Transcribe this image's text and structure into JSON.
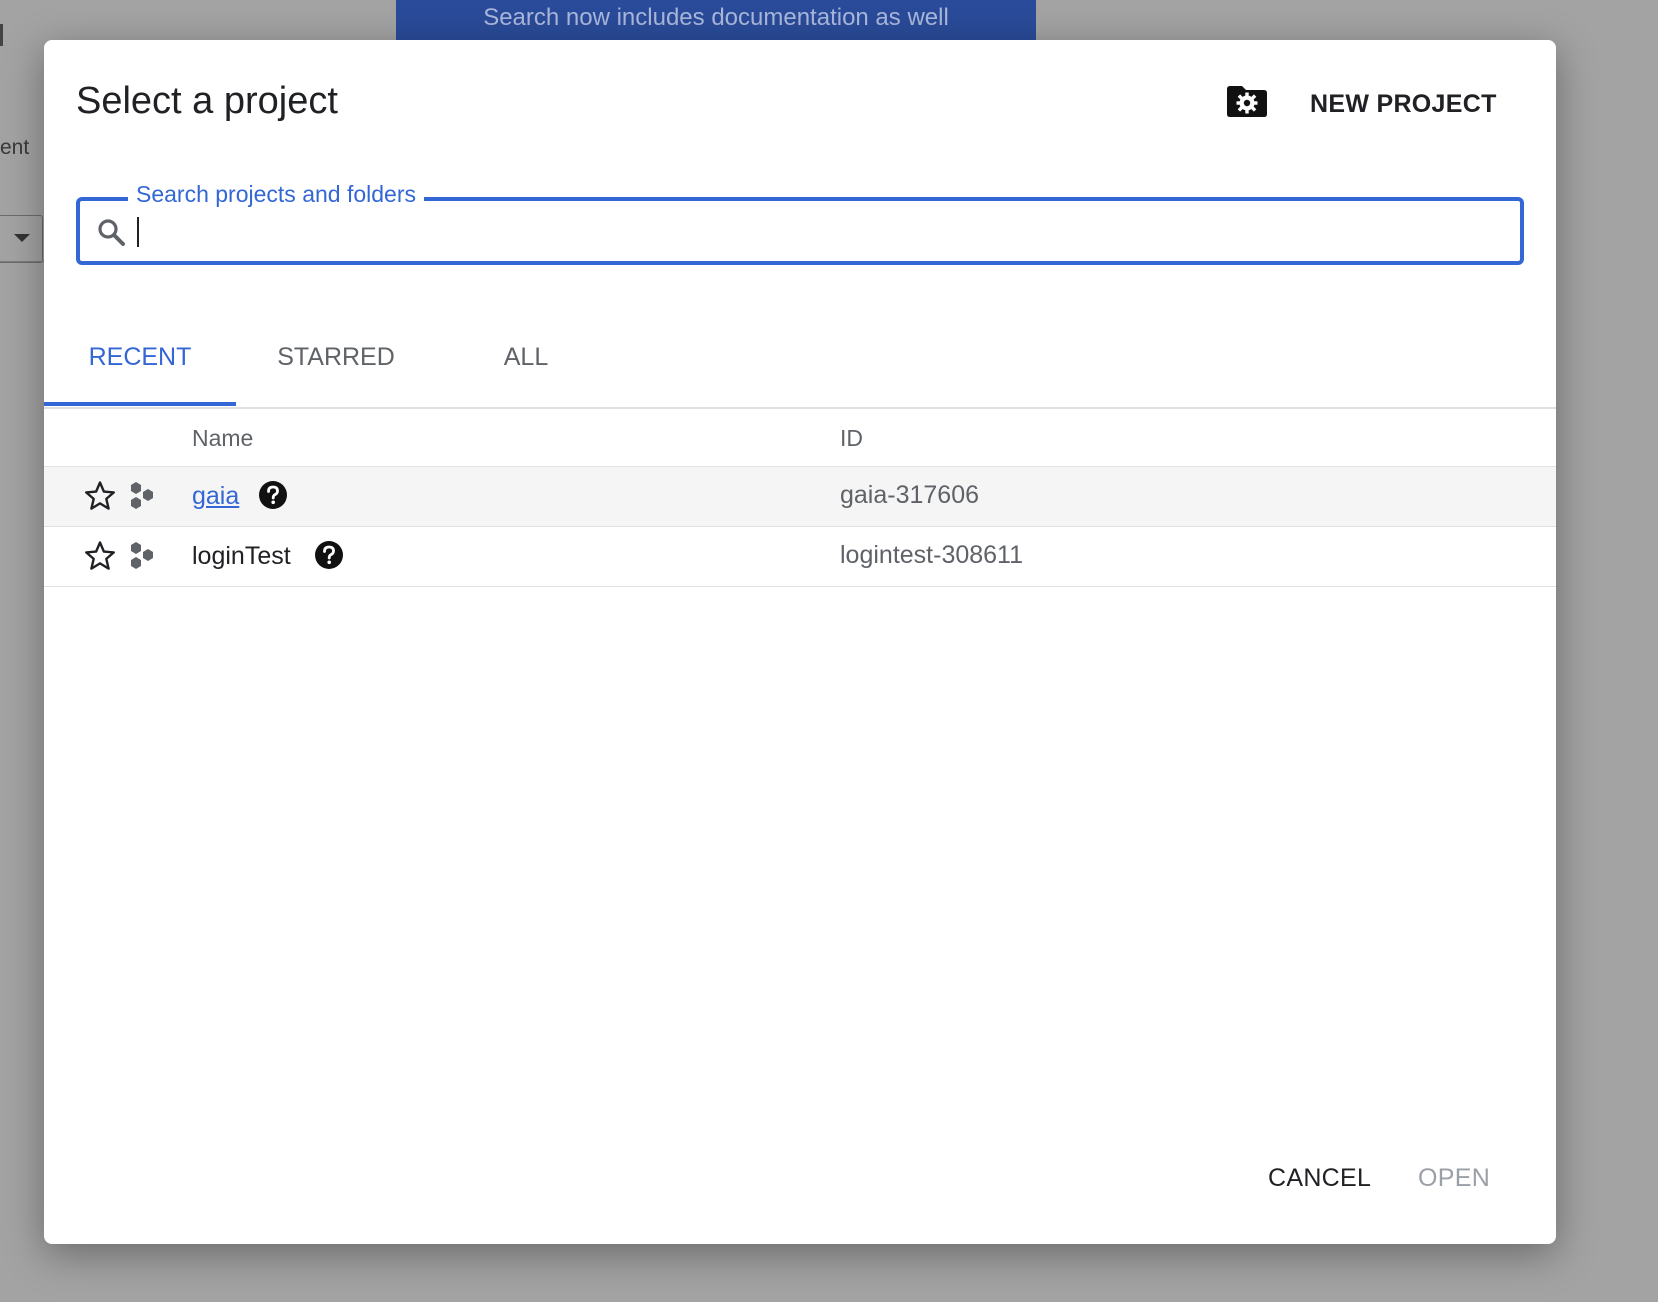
{
  "background": {
    "toast_text": "Search now includes documentation as well",
    "fragment_text": "ent"
  },
  "dialog": {
    "title": "Select a project",
    "new_project_label": "NEW PROJECT",
    "search": {
      "label": "Search projects and folders",
      "value": "",
      "placeholder": ""
    },
    "tabs": [
      {
        "label": "RECENT",
        "active": true
      },
      {
        "label": "STARRED",
        "active": false
      },
      {
        "label": "ALL",
        "active": false
      }
    ],
    "table": {
      "headers": {
        "name": "Name",
        "id": "ID"
      },
      "rows": [
        {
          "name": "gaia",
          "id": "gaia-317606",
          "starred": false
        },
        {
          "name": "loginTest",
          "id": "logintest-308611",
          "starred": false
        }
      ]
    },
    "cancel_label": "CANCEL",
    "open_label": "OPEN"
  },
  "colors": {
    "accent": "#3367d6",
    "toast_bg": "#2a4b99",
    "row_highlight": "#f5f5f5"
  },
  "icons": {
    "new_project": "folder-settings-icon",
    "search": "search-icon",
    "star": "star-outline-icon",
    "project": "project-hexagons-icon",
    "help": "help-circle-icon"
  }
}
